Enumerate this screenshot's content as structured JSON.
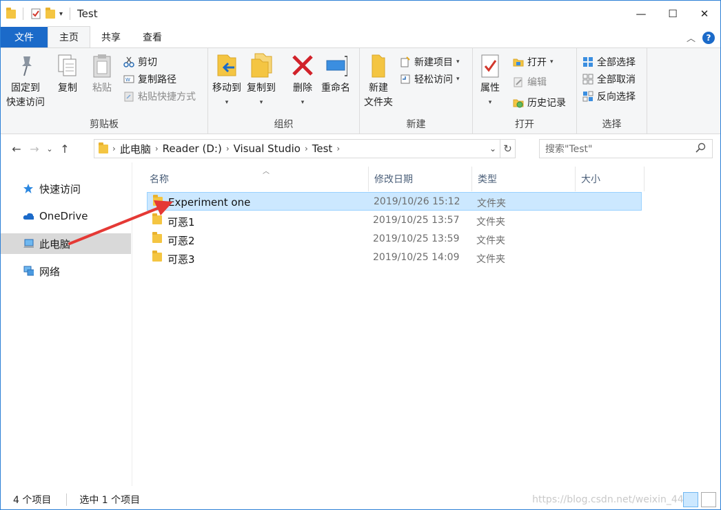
{
  "window": {
    "title": "Test",
    "minimize": "—",
    "maximize": "☐",
    "close": "✕"
  },
  "tabs": [
    {
      "label": "文件"
    },
    {
      "label": "主页"
    },
    {
      "label": "共享"
    },
    {
      "label": "查看"
    }
  ],
  "ribbon": {
    "clipboard": {
      "label": "剪贴板",
      "pin_line1": "固定到",
      "pin_line2": "快速访问",
      "copy": "复制",
      "paste": "粘贴",
      "cut": "剪切",
      "copy_path": "复制路径",
      "paste_shortcut": "粘贴快捷方式"
    },
    "organize": {
      "label": "组织",
      "move_to": "移动到",
      "copy_to": "复制到",
      "delete": "删除",
      "rename": "重命名"
    },
    "new": {
      "label": "新建",
      "new_folder_line1": "新建",
      "new_folder_line2": "文件夹",
      "new_item": "新建项目",
      "easy_access": "轻松访问"
    },
    "open": {
      "label": "打开",
      "properties": "属性",
      "open": "打开",
      "edit": "编辑",
      "history": "历史记录"
    },
    "select": {
      "label": "选择",
      "select_all": "全部选择",
      "select_none": "全部取消",
      "invert": "反向选择"
    }
  },
  "address": {
    "crumbs": [
      "此电脑",
      "Reader (D:)",
      "Visual Studio",
      "Test"
    ],
    "search_placeholder": "搜索\"Test\""
  },
  "nav_pane": [
    {
      "label": "快速访问"
    },
    {
      "label": "OneDrive"
    },
    {
      "label": "此电脑"
    },
    {
      "label": "网络"
    }
  ],
  "columns": [
    "名称",
    "修改日期",
    "类型",
    "大小"
  ],
  "files": [
    {
      "name": "Experiment one",
      "date": "2019/10/26 15:12",
      "type": "文件夹"
    },
    {
      "name": "可恶1",
      "date": "2019/10/25 13:57",
      "type": "文件夹"
    },
    {
      "name": "可恶2",
      "date": "2019/10/25 13:59",
      "type": "文件夹"
    },
    {
      "name": "可恶3",
      "date": "2019/10/25 14:09",
      "type": "文件夹"
    }
  ],
  "status": {
    "count": "4 个项目",
    "selected": "选中 1 个项目"
  },
  "watermark": "https://blog.csdn.net/weixin_44...",
  "colors": {
    "accent": "#1b6ac9",
    "selection": "#cce8ff",
    "folder": "#f4c542",
    "arrow": "#e53935"
  }
}
